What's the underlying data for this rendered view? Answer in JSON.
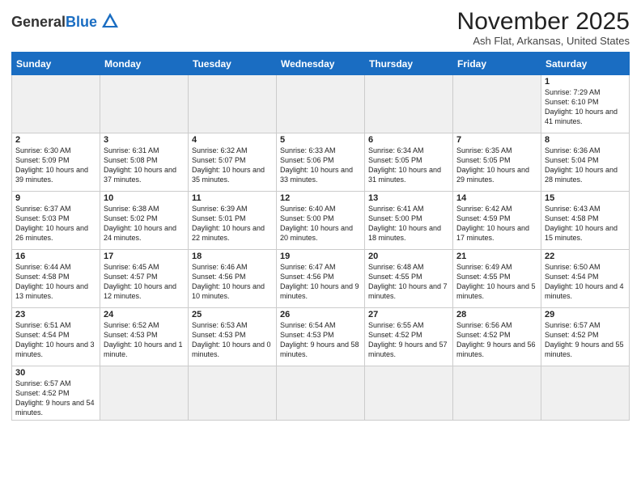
{
  "logo": {
    "text_general": "General",
    "text_blue": "Blue"
  },
  "title": "November 2025",
  "subtitle": "Ash Flat, Arkansas, United States",
  "weekdays": [
    "Sunday",
    "Monday",
    "Tuesday",
    "Wednesday",
    "Thursday",
    "Friday",
    "Saturday"
  ],
  "weeks": [
    [
      {
        "day": "",
        "info": ""
      },
      {
        "day": "",
        "info": ""
      },
      {
        "day": "",
        "info": ""
      },
      {
        "day": "",
        "info": ""
      },
      {
        "day": "",
        "info": ""
      },
      {
        "day": "",
        "info": ""
      },
      {
        "day": "1",
        "info": "Sunrise: 7:29 AM\nSunset: 6:10 PM\nDaylight: 10 hours and 41 minutes."
      }
    ],
    [
      {
        "day": "2",
        "info": "Sunrise: 6:30 AM\nSunset: 5:09 PM\nDaylight: 10 hours and 39 minutes."
      },
      {
        "day": "3",
        "info": "Sunrise: 6:31 AM\nSunset: 5:08 PM\nDaylight: 10 hours and 37 minutes."
      },
      {
        "day": "4",
        "info": "Sunrise: 6:32 AM\nSunset: 5:07 PM\nDaylight: 10 hours and 35 minutes."
      },
      {
        "day": "5",
        "info": "Sunrise: 6:33 AM\nSunset: 5:06 PM\nDaylight: 10 hours and 33 minutes."
      },
      {
        "day": "6",
        "info": "Sunrise: 6:34 AM\nSunset: 5:05 PM\nDaylight: 10 hours and 31 minutes."
      },
      {
        "day": "7",
        "info": "Sunrise: 6:35 AM\nSunset: 5:05 PM\nDaylight: 10 hours and 29 minutes."
      },
      {
        "day": "8",
        "info": "Sunrise: 6:36 AM\nSunset: 5:04 PM\nDaylight: 10 hours and 28 minutes."
      }
    ],
    [
      {
        "day": "9",
        "info": "Sunrise: 6:37 AM\nSunset: 5:03 PM\nDaylight: 10 hours and 26 minutes."
      },
      {
        "day": "10",
        "info": "Sunrise: 6:38 AM\nSunset: 5:02 PM\nDaylight: 10 hours and 24 minutes."
      },
      {
        "day": "11",
        "info": "Sunrise: 6:39 AM\nSunset: 5:01 PM\nDaylight: 10 hours and 22 minutes."
      },
      {
        "day": "12",
        "info": "Sunrise: 6:40 AM\nSunset: 5:00 PM\nDaylight: 10 hours and 20 minutes."
      },
      {
        "day": "13",
        "info": "Sunrise: 6:41 AM\nSunset: 5:00 PM\nDaylight: 10 hours and 18 minutes."
      },
      {
        "day": "14",
        "info": "Sunrise: 6:42 AM\nSunset: 4:59 PM\nDaylight: 10 hours and 17 minutes."
      },
      {
        "day": "15",
        "info": "Sunrise: 6:43 AM\nSunset: 4:58 PM\nDaylight: 10 hours and 15 minutes."
      }
    ],
    [
      {
        "day": "16",
        "info": "Sunrise: 6:44 AM\nSunset: 4:58 PM\nDaylight: 10 hours and 13 minutes."
      },
      {
        "day": "17",
        "info": "Sunrise: 6:45 AM\nSunset: 4:57 PM\nDaylight: 10 hours and 12 minutes."
      },
      {
        "day": "18",
        "info": "Sunrise: 6:46 AM\nSunset: 4:56 PM\nDaylight: 10 hours and 10 minutes."
      },
      {
        "day": "19",
        "info": "Sunrise: 6:47 AM\nSunset: 4:56 PM\nDaylight: 10 hours and 9 minutes."
      },
      {
        "day": "20",
        "info": "Sunrise: 6:48 AM\nSunset: 4:55 PM\nDaylight: 10 hours and 7 minutes."
      },
      {
        "day": "21",
        "info": "Sunrise: 6:49 AM\nSunset: 4:55 PM\nDaylight: 10 hours and 5 minutes."
      },
      {
        "day": "22",
        "info": "Sunrise: 6:50 AM\nSunset: 4:54 PM\nDaylight: 10 hours and 4 minutes."
      }
    ],
    [
      {
        "day": "23",
        "info": "Sunrise: 6:51 AM\nSunset: 4:54 PM\nDaylight: 10 hours and 3 minutes."
      },
      {
        "day": "24",
        "info": "Sunrise: 6:52 AM\nSunset: 4:53 PM\nDaylight: 10 hours and 1 minute."
      },
      {
        "day": "25",
        "info": "Sunrise: 6:53 AM\nSunset: 4:53 PM\nDaylight: 10 hours and 0 minutes."
      },
      {
        "day": "26",
        "info": "Sunrise: 6:54 AM\nSunset: 4:53 PM\nDaylight: 9 hours and 58 minutes."
      },
      {
        "day": "27",
        "info": "Sunrise: 6:55 AM\nSunset: 4:52 PM\nDaylight: 9 hours and 57 minutes."
      },
      {
        "day": "28",
        "info": "Sunrise: 6:56 AM\nSunset: 4:52 PM\nDaylight: 9 hours and 56 minutes."
      },
      {
        "day": "29",
        "info": "Sunrise: 6:57 AM\nSunset: 4:52 PM\nDaylight: 9 hours and 55 minutes."
      }
    ],
    [
      {
        "day": "30",
        "info": "Sunrise: 6:57 AM\nSunset: 4:52 PM\nDaylight: 9 hours and 54 minutes."
      },
      {
        "day": "",
        "info": ""
      },
      {
        "day": "",
        "info": ""
      },
      {
        "day": "",
        "info": ""
      },
      {
        "day": "",
        "info": ""
      },
      {
        "day": "",
        "info": ""
      },
      {
        "day": "",
        "info": ""
      }
    ]
  ]
}
